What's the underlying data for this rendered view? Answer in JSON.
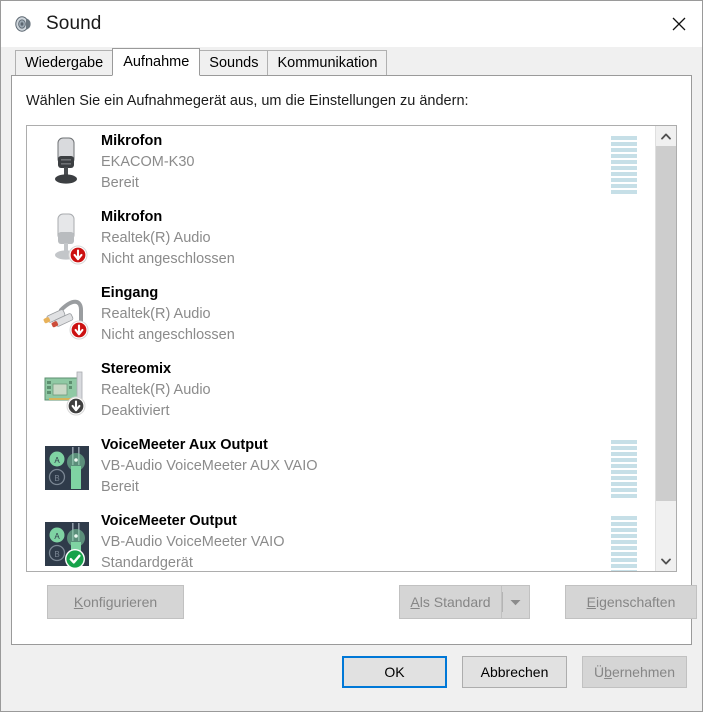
{
  "window": {
    "title": "Sound",
    "icon": "speaker-icon",
    "close_label": "✕"
  },
  "tabs": [
    {
      "label": "Wiedergabe",
      "selected": false
    },
    {
      "label": "Aufnahme",
      "selected": true
    },
    {
      "label": "Sounds",
      "selected": false
    },
    {
      "label": "Kommunikation",
      "selected": false
    }
  ],
  "instruction": "Wählen Sie ein Aufnahmegerät aus, um die Einstellungen zu ändern:",
  "devices": [
    {
      "name": "Mikrofon",
      "description": "EKACOM-K30",
      "status": "Bereit",
      "icon": "microphone-dark-icon",
      "badge": "none",
      "meter_segments": 10
    },
    {
      "name": "Mikrofon",
      "description": "Realtek(R) Audio",
      "status": "Nicht angeschlossen",
      "icon": "microphone-light-icon",
      "badge": "unplugged-red-arrow-badge",
      "meter_segments": 0
    },
    {
      "name": "Eingang",
      "description": "Realtek(R) Audio",
      "status": "Nicht angeschlossen",
      "icon": "line-in-jack-icon",
      "badge": "unplugged-red-arrow-badge",
      "meter_segments": 0
    },
    {
      "name": "Stereomix",
      "description": "Realtek(R) Audio",
      "status": "Deaktiviert",
      "icon": "sound-card-icon",
      "badge": "disabled-gray-arrow-badge",
      "meter_segments": 0
    },
    {
      "name": "VoiceMeeter Aux Output",
      "description": "VB-Audio VoiceMeeter AUX VAIO",
      "status": "Bereit",
      "icon": "voicemeeter-icon",
      "badge": "none",
      "meter_segments": 10
    },
    {
      "name": "VoiceMeeter Output",
      "description": "VB-Audio VoiceMeeter VAIO",
      "status": "Standardgerät",
      "icon": "voicemeeter-icon",
      "badge": "default-green-check-badge",
      "meter_segments": 10
    }
  ],
  "panel_buttons": {
    "configure": {
      "label": "Konfigurieren",
      "accelerator": "K",
      "enabled": false
    },
    "set_default": {
      "label": "Als Standard",
      "accelerator": "A",
      "enabled": false
    },
    "set_default_dropdown": {
      "icon": "chevron-down-icon",
      "enabled": false
    },
    "properties": {
      "label": "Eigenschaften",
      "accelerator": "E",
      "enabled": false
    }
  },
  "footer_buttons": {
    "ok": {
      "label": "OK",
      "default": true,
      "enabled": true
    },
    "cancel": {
      "label": "Abbrechen",
      "enabled": true
    },
    "apply": {
      "label": "Übernehmen",
      "accelerator": "b",
      "enabled": false
    }
  },
  "scrollbar": {
    "up_icon": "chevron-up-icon",
    "down_icon": "chevron-down-icon",
    "thumb_position": "top"
  },
  "colors": {
    "accent": "#0078d7",
    "meter_segment": "#c6dfe7",
    "status_text": "#8b8b8b",
    "default_badge": "#16a34a",
    "unplugged_badge": "#cc1111",
    "window_bg": "#f0f0f0",
    "panel_bg": "#ffffff"
  }
}
